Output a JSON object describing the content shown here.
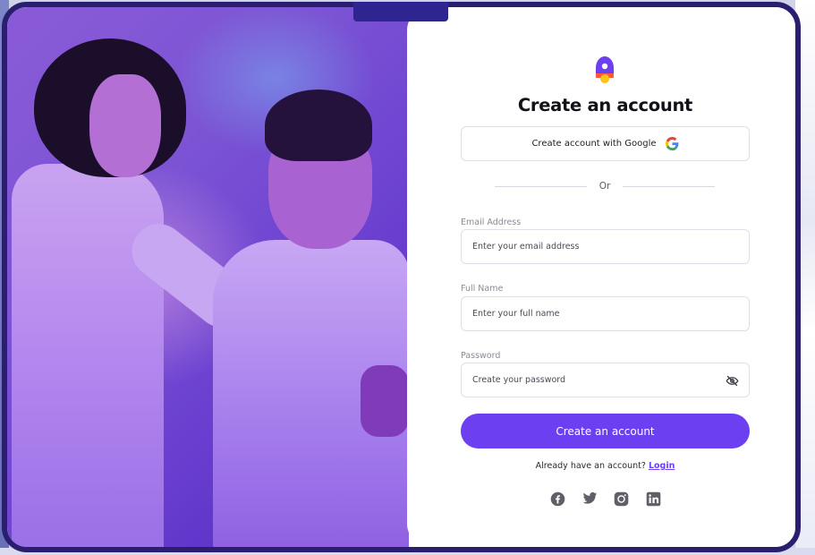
{
  "form": {
    "title": "Create an account",
    "google_button_label": "Create account with Google",
    "divider_text": "Or",
    "email": {
      "label": "Email Address",
      "placeholder": "Enter your email address"
    },
    "full_name": {
      "label": "Full Name",
      "placeholder": "Enter your full name"
    },
    "password": {
      "label": "Password",
      "placeholder": "Create your password"
    },
    "submit_label": "Create an account",
    "login_prompt": "Already have an account?",
    "login_link": "Login"
  },
  "socials": [
    "facebook-icon",
    "twitter-icon",
    "instagram-icon",
    "linkedin-icon"
  ],
  "colors": {
    "accent": "#6c3ff0",
    "frame": "#2a1f6e",
    "photo_tint": "#6a3fd0"
  }
}
